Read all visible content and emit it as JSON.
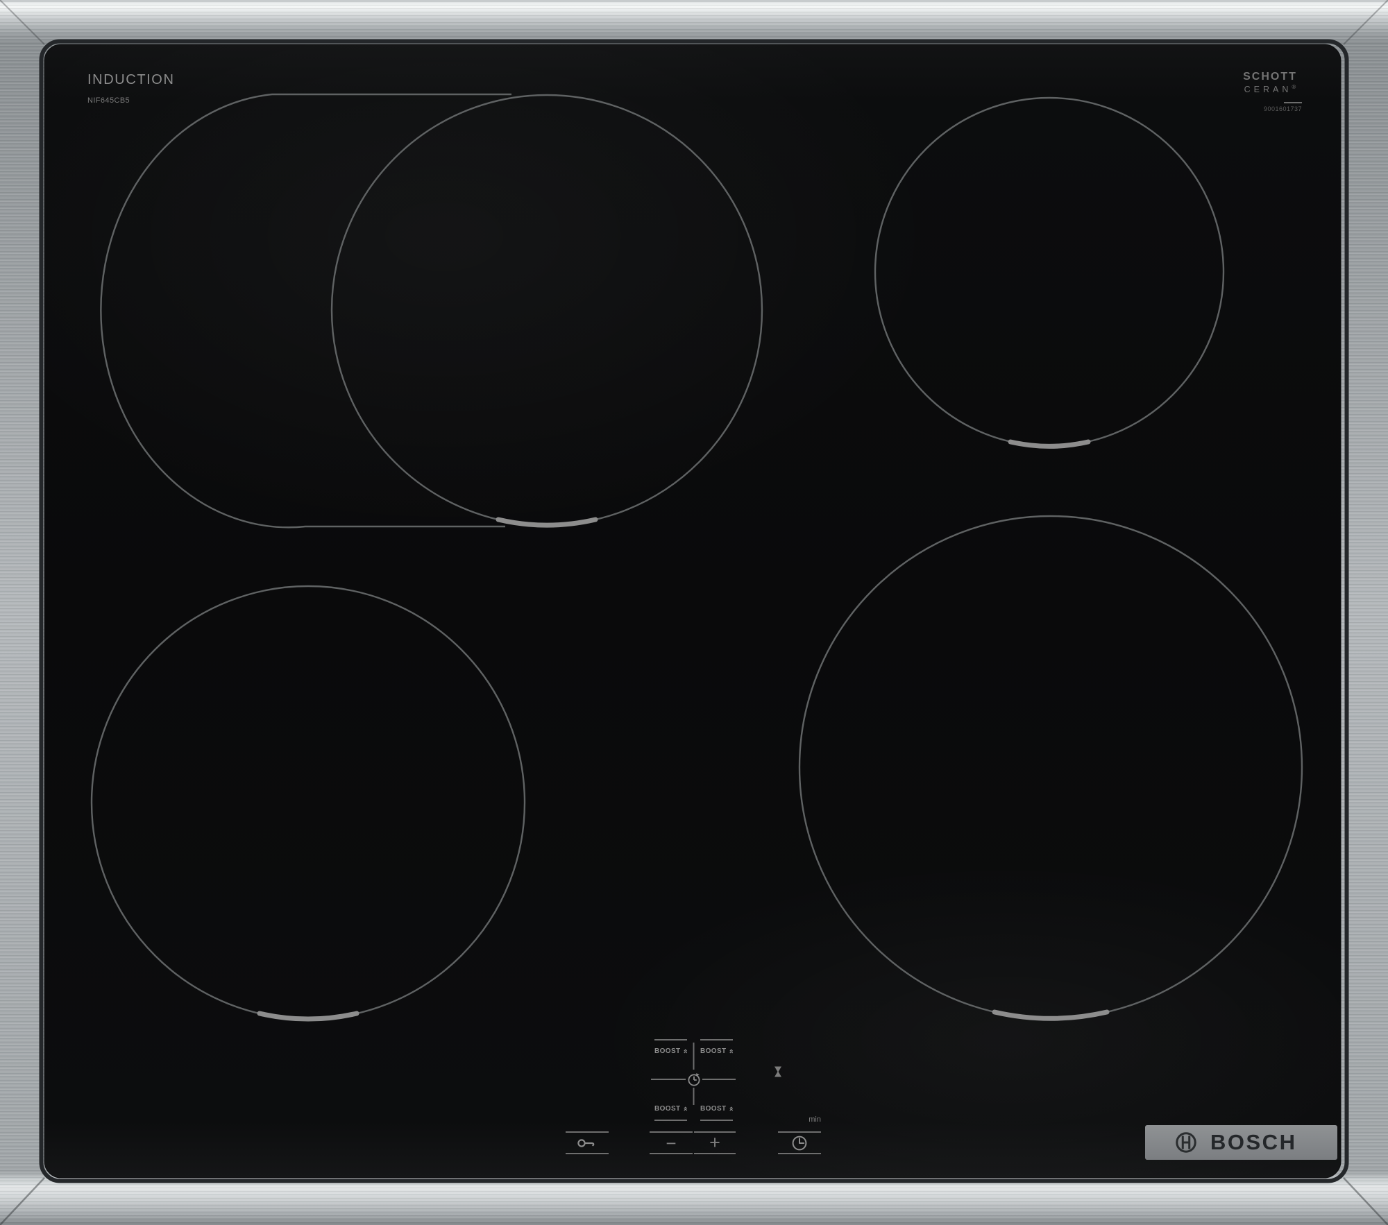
{
  "product": {
    "type_label": "INDUCTION",
    "model_number": "NIF645CB5"
  },
  "glass_brand": {
    "line1": "SCHOTT",
    "line2": "CERAN",
    "registered": "®",
    "print_number": "9001601737"
  },
  "brand": {
    "name": "BOSCH"
  },
  "controls": {
    "boost_label": "BOOST",
    "minus_label": "−",
    "plus_label": "+",
    "timer_unit_label": "min",
    "icons": {
      "boost": "double-chevron-up-icon",
      "timer_zone_select": "clock-arrow-icon",
      "timer_indicator": "hourglass-icon",
      "child_lock": "key-icon",
      "timer": "clock-icon",
      "brand_symbol": "bosch-armature-icon"
    }
  },
  "zones": [
    {
      "id": "rear-left-flex",
      "shape": "oval-with-circle",
      "marker": "bottom-notch"
    },
    {
      "id": "rear-right",
      "shape": "circle",
      "marker": "bottom-notch"
    },
    {
      "id": "front-left",
      "shape": "circle",
      "marker": "bottom-notch"
    },
    {
      "id": "front-right",
      "shape": "circle-large",
      "marker": "bottom-notch"
    }
  ],
  "colors": {
    "frame_steel_mid": "#b2b6b9",
    "glass_black": "#0b0b0c",
    "zone_ring": "#5f6263",
    "zone_marker": "#8d8d8d",
    "control_gray": "#8d8d8d",
    "badge_plate": "#85888a",
    "badge_text": "#24272a"
  }
}
